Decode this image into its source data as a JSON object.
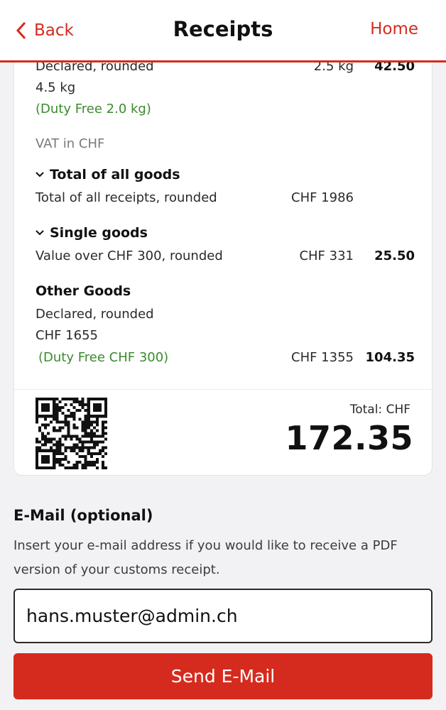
{
  "header": {
    "back_label": "Back",
    "title": "Receipts",
    "home_label": "Home"
  },
  "receipt": {
    "weight_section": {
      "declared_label": "Declared, rounded",
      "weight_value": "4.5 kg",
      "duty_free": "(Duty Free 2.0 kg)",
      "taxable_amount": "2.5 kg",
      "duty": "42.50"
    },
    "vat_label": "VAT in CHF",
    "total_all_goods": {
      "heading": "Total of all goods",
      "label": "Total of all receipts, rounded",
      "amount": "CHF 1986"
    },
    "single_goods": {
      "heading": "Single goods",
      "label": "Value over CHF 300, rounded",
      "amount": "CHF 331",
      "duty": "25.50"
    },
    "other_goods": {
      "heading": "Other Goods",
      "declared_label": "Declared, rounded",
      "declared_value": "CHF 1655",
      "duty_free": "(Duty Free CHF 300)",
      "taxable_amount": "CHF 1355",
      "duty": "104.35"
    },
    "total": {
      "label": "Total: CHF",
      "value": "172.35"
    }
  },
  "email": {
    "heading": "E-Mail (optional)",
    "help_text": "Insert your e-mail address if you would like to receive a PDF version of your customs receipt.",
    "value": "hans.muster@admin.ch",
    "send_label": "Send E-Mail"
  },
  "colors": {
    "accent": "#d52b1e",
    "duty_free_green": "#3b8a2e"
  },
  "icons": {
    "back": "chevron-left-icon",
    "expand": "chevron-down-icon",
    "qr": "qr-code-icon"
  }
}
